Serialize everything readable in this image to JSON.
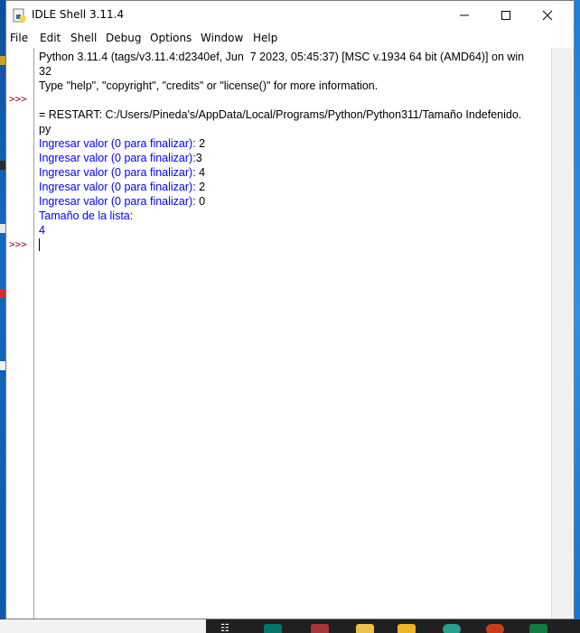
{
  "window": {
    "title": "IDLE Shell 3.11.4",
    "controls": {
      "minimize": "–",
      "maximize": "☐",
      "close": "✕"
    }
  },
  "menubar": {
    "items": [
      "File",
      "Edit",
      "Shell",
      "Debug",
      "Options",
      "Window",
      "Help"
    ]
  },
  "gutter": {
    "prompts": [
      ">>>",
      ">>>"
    ]
  },
  "shell": {
    "lines": [
      {
        "text": "Python 3.11.4 (tags/v3.11.4:d2340ef, Jun  7 2023, 05:45:37) [MSC v.1934 64 bit (AMD64)] on win",
        "kind": "normal"
      },
      {
        "text": "32",
        "kind": "normal"
      },
      {
        "text": "Type \"help\", \"copyright\", \"credits\" or \"license()\" for more information.",
        "kind": "normal"
      },
      {
        "text": "",
        "kind": "normal"
      },
      {
        "text": "= RESTART: C:/Users/Pineda's/AppData/Local/Programs/Python/Python311/Tamaño Indefenido.",
        "kind": "normal"
      },
      {
        "text": "py",
        "kind": "normal"
      }
    ],
    "io": [
      {
        "prompt": "Ingresar valor (0 para finalizar): ",
        "input": "2"
      },
      {
        "prompt": "Ingresar valor (0 para finalizar):",
        "input": "3"
      },
      {
        "prompt": "Ingresar valor (0 para finalizar): ",
        "input": "4"
      },
      {
        "prompt": "Ingresar valor (0 para finalizar): ",
        "input": "2"
      },
      {
        "prompt": "Ingresar valor (0 para finalizar): ",
        "input": "0"
      }
    ],
    "output": [
      "Tamaño de la lista:",
      "4"
    ]
  },
  "colors": {
    "prompt": "#a0001e",
    "stdout": "#0000ff",
    "taskbar": "#202020"
  },
  "taskbar": {
    "icons": [
      "task-view-icon",
      "publisher-icon",
      "access-icon",
      "python-icon",
      "file-explorer-icon",
      "edge-icon",
      "powerpoint-icon",
      "excel-icon"
    ]
  }
}
